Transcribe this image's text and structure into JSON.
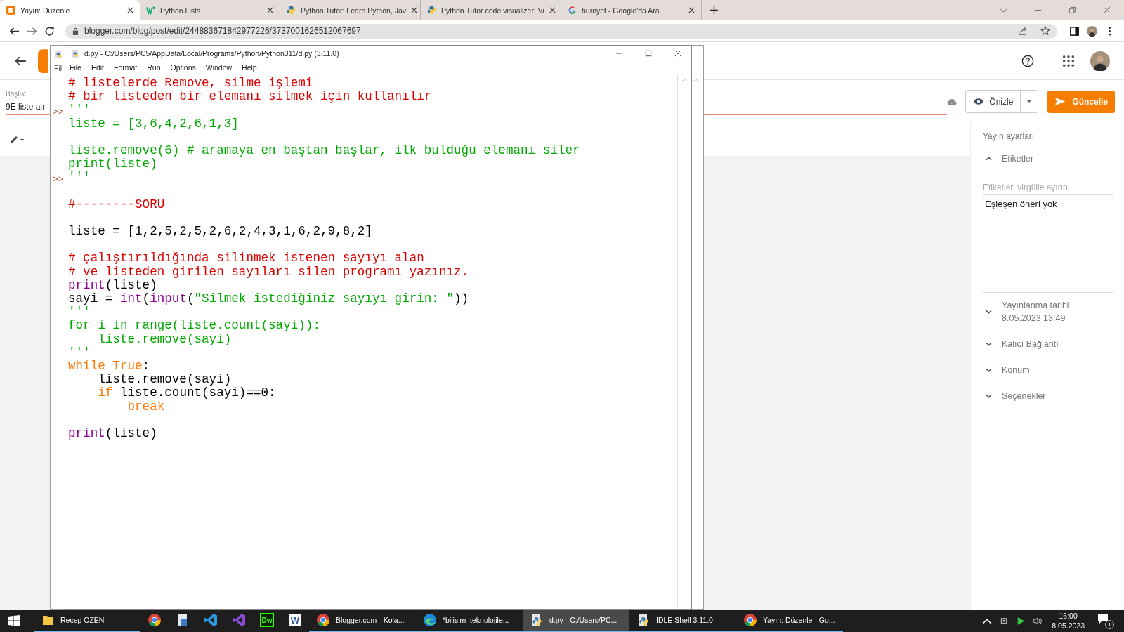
{
  "browser": {
    "tabs": [
      {
        "kind": "blogger",
        "title": "Yayın: Düzenle",
        "selected": true
      },
      {
        "kind": "w3",
        "title": "Python Lists",
        "selected": false
      },
      {
        "kind": "python",
        "title": "Python Tutor: Learn Python, Jav",
        "selected": false
      },
      {
        "kind": "python",
        "title": "Python Tutor code visualizer: Vi",
        "selected": false
      },
      {
        "kind": "google",
        "title": "hurriyet - Google'da Ara",
        "selected": false
      }
    ],
    "address": "blogger.com/blog/post/edit/244883671842977226/3737001626512067697"
  },
  "blogger": {
    "title_label": "Başlık",
    "title_value": "9E liste alı",
    "preview_button": "Önizle",
    "update_button": "Güncelle",
    "settings": {
      "heading": "Yayın ayarları",
      "sections": [
        {
          "title": "Etiketler",
          "expanded": true,
          "placeholder": "Etiketleri virgülle ayırın",
          "suggestion": "Eşleşen öneri yok"
        },
        {
          "title": "Yayınlanma tarihi",
          "subtitle": "8.05.2023 13:49",
          "expanded": false
        },
        {
          "title": "Kalıcı Bağlantı",
          "expanded": false
        },
        {
          "title": "Konum",
          "expanded": false
        },
        {
          "title": "Seçenekler",
          "expanded": false
        }
      ]
    }
  },
  "shell_window": {
    "menu": "Fil",
    "prompts": [
      ">>",
      ">>"
    ]
  },
  "editor_window": {
    "title": "d.py - C:/Users/PC5/AppData/Local/Programs/Python/Python311/d.py (3.11.0)",
    "menu": [
      "File",
      "Edit",
      "Format",
      "Run",
      "Options",
      "Window",
      "Help"
    ],
    "lines": [
      {
        "kind": "code",
        "segments": [
          {
            "kind": "comment",
            "text": "# listelerde Remove, silme işlemi"
          }
        ]
      },
      {
        "kind": "code",
        "segments": [
          {
            "kind": "comment",
            "text": "# bir listeden bir elemanı silmek için kullanılır"
          }
        ]
      },
      {
        "kind": "code",
        "segments": [
          {
            "kind": "string",
            "text": "'''"
          }
        ]
      },
      {
        "kind": "code",
        "segments": [
          {
            "kind": "string",
            "text": "liste = [3,6,4,2,6,1,3]"
          }
        ]
      },
      {
        "kind": "blank"
      },
      {
        "kind": "code",
        "segments": [
          {
            "kind": "string",
            "text": "liste.remove(6) # aramaya en baştan başlar, ilk bulduğu elemanı siler"
          }
        ]
      },
      {
        "kind": "code",
        "segments": [
          {
            "kind": "string",
            "text": "print(liste)"
          }
        ]
      },
      {
        "kind": "code",
        "segments": [
          {
            "kind": "string",
            "text": "'''"
          }
        ]
      },
      {
        "kind": "blank"
      },
      {
        "kind": "code",
        "segments": [
          {
            "kind": "comment",
            "text": "#--------SORU"
          }
        ]
      },
      {
        "kind": "blank"
      },
      {
        "kind": "code",
        "segments": [
          {
            "kind": "plain",
            "text": "liste = [1,2,5,2,5,2,6,2,4,3,1,6,2,9,8,2]"
          }
        ]
      },
      {
        "kind": "blank"
      },
      {
        "kind": "code",
        "segments": [
          {
            "kind": "comment",
            "text": "# çalıştırıldığında silinmek istenen sayıyı alan"
          }
        ]
      },
      {
        "kind": "code",
        "segments": [
          {
            "kind": "comment",
            "text": "# ve listeden girilen sayıları silen programı yazınız."
          }
        ]
      },
      {
        "kind": "code",
        "segments": [
          {
            "kind": "builtin",
            "text": "print"
          },
          {
            "kind": "plain",
            "text": "(liste)"
          }
        ]
      },
      {
        "kind": "code",
        "segments": [
          {
            "kind": "plain",
            "text": "sayi = "
          },
          {
            "kind": "builtin",
            "text": "int"
          },
          {
            "kind": "plain",
            "text": "("
          },
          {
            "kind": "builtin",
            "text": "input"
          },
          {
            "kind": "plain",
            "text": "("
          },
          {
            "kind": "string",
            "text": "\"Silmek istediğiniz sayıyı girin: \""
          },
          {
            "kind": "plain",
            "text": "))"
          }
        ]
      },
      {
        "kind": "code",
        "segments": [
          {
            "kind": "string",
            "text": "'''"
          }
        ]
      },
      {
        "kind": "code",
        "segments": [
          {
            "kind": "string",
            "text": "for i in range(liste.count(sayi)):"
          }
        ]
      },
      {
        "kind": "code",
        "segments": [
          {
            "kind": "string",
            "text": "    liste.remove(sayi)"
          }
        ]
      },
      {
        "kind": "code",
        "segments": [
          {
            "kind": "string",
            "text": "'''"
          }
        ]
      },
      {
        "kind": "code",
        "segments": [
          {
            "kind": "keyword",
            "text": "while True"
          },
          {
            "kind": "plain",
            "text": ":"
          }
        ]
      },
      {
        "kind": "code",
        "segments": [
          {
            "kind": "plain",
            "text": "    liste.remove(sayi)"
          }
        ]
      },
      {
        "kind": "code",
        "segments": [
          {
            "kind": "keyword",
            "text": "    if"
          },
          {
            "kind": "plain",
            "text": " liste.count(sayi)==0:"
          }
        ]
      },
      {
        "kind": "code",
        "segments": [
          {
            "kind": "keyword",
            "text": "        break"
          }
        ]
      },
      {
        "kind": "blank"
      },
      {
        "kind": "code",
        "segments": [
          {
            "kind": "builtin",
            "text": "print"
          },
          {
            "kind": "plain",
            "text": "(liste)"
          }
        ]
      }
    ]
  },
  "taskbar": {
    "items": [
      {
        "kind": "folder",
        "label": "Recep ÖZEN",
        "selected": false
      },
      {
        "kind": "chrome",
        "selected": false
      },
      {
        "kind": "storage",
        "selected": false
      },
      {
        "kind": "vscode",
        "selected": false
      },
      {
        "kind": "vs",
        "selected": false
      },
      {
        "kind": "dw",
        "glyph": "Dw",
        "selected": false
      },
      {
        "kind": "word",
        "glyph": "W",
        "selected": false
      },
      {
        "kind": "chrome",
        "label": "Blogger.com - Kola...",
        "selected": false
      },
      {
        "kind": "edge",
        "label": "*bilisim_teknolojile...",
        "selected": false
      },
      {
        "kind": "python",
        "label": "d.py - C:/Users/PC...",
        "selected": true
      },
      {
        "kind": "python",
        "label": "IDLE Shell 3.11.0",
        "selected": false
      },
      {
        "kind": "chrome",
        "label": "Yayın: Düzenle - Go...",
        "selected": false
      }
    ],
    "tray": {
      "time": "16:00",
      "date": "8.05.2023",
      "notifications": "1"
    }
  }
}
